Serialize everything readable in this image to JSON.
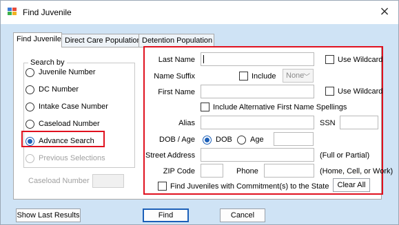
{
  "window": {
    "title": "Find Juvenile"
  },
  "tabs": [
    "Find Juvenile",
    "Direct Care Population",
    "Detention Population"
  ],
  "search_by": {
    "label": "Search by",
    "options": [
      "Juvenile Number",
      "DC Number",
      "Intake Case Number",
      "Caseload Number",
      "Advance Search",
      "Previous Selections"
    ],
    "selected": "Advance Search"
  },
  "caseload_number_label": "Caseload Number",
  "form": {
    "last_name_label": "Last Name",
    "last_name_value": "",
    "use_wildcard_1": "Use Wildcard",
    "name_suffix_label": "Name Suffix",
    "include_label": "Include",
    "suffix_value": "None",
    "first_name_label": "First Name",
    "first_name_value": "",
    "use_wildcard_2": "Use Wildcard",
    "alt_spellings_label": "Include Alternative First Name Spellings",
    "alias_label": "Alias",
    "ssn_label": "SSN",
    "dob_age_label": "DOB / Age",
    "dob_option": "DOB",
    "age_option": "Age",
    "street_address_label": "Street Address",
    "street_address_hint": "(Full or Partial)",
    "zip_code_label": "ZIP Code",
    "phone_label": "Phone",
    "phone_hint": "(Home, Cell, or Work)",
    "commitment_label": "Find Juveniles with Commitment(s) to the State",
    "clear_all": "Clear All"
  },
  "footer": {
    "show_last_results": "Show Last Results",
    "find": "Find",
    "cancel": "Cancel"
  },
  "colors": {
    "highlight": "#e0101e",
    "accent": "#1b5fb8",
    "backdrop": "#cfe3f5"
  }
}
